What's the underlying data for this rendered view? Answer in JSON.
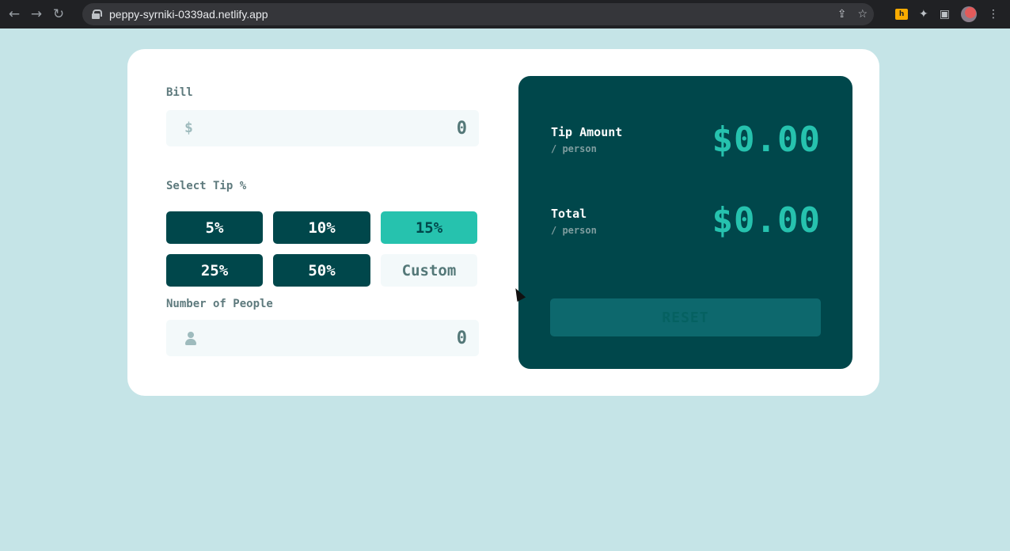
{
  "browser": {
    "url": "peppy-syrniki-0339ad.netlify.app",
    "back_icon": "←",
    "forward_icon": "→",
    "reload_icon": "↻",
    "share_icon": "⇪",
    "star_icon": "☆",
    "ext_badge": "h",
    "puzzle_icon": "✦",
    "sidepanel_icon": "▣",
    "menu_icon": "⋮"
  },
  "calculator": {
    "bill": {
      "label": "Bill",
      "currency_icon": "$",
      "placeholder": "0"
    },
    "tip": {
      "label": "Select Tip %",
      "options": [
        "5%",
        "10%",
        "15%",
        "25%",
        "50%"
      ],
      "selected": "15%",
      "custom_placeholder": "Custom"
    },
    "people": {
      "label": "Number of People",
      "placeholder": "0"
    }
  },
  "results": {
    "tip_amount": {
      "label": "Tip Amount",
      "sub": "/ person",
      "value": "$0.00"
    },
    "total": {
      "label": "Total",
      "sub": "/ person",
      "value": "$0.00"
    },
    "reset_label": "RESET"
  },
  "colors": {
    "background": "#c5e4e7",
    "dark_cyan": "#00474b",
    "strong_cyan": "#26c2ae",
    "input_bg": "#f3f9fa",
    "label_grey": "#5e7a7d"
  }
}
